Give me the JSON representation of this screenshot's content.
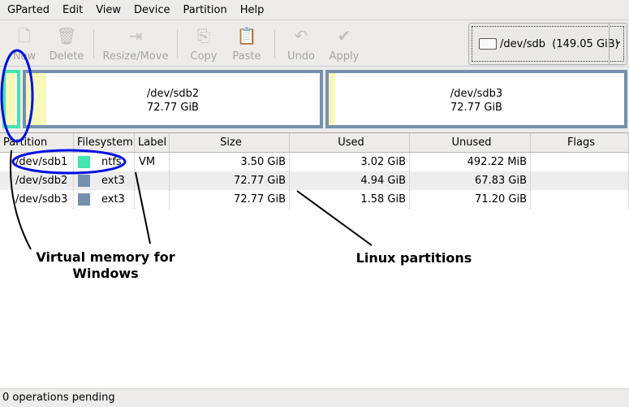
{
  "menu": [
    "GParted",
    "Edit",
    "View",
    "Device",
    "Partition",
    "Help"
  ],
  "toolbar": {
    "new": "New",
    "delete": "Delete",
    "resize": "Resize/Move",
    "copy": "Copy",
    "paste": "Paste",
    "undo": "Undo",
    "apply": "Apply"
  },
  "device": {
    "name": "/dev/sdb",
    "size": "(149.05 GiB)"
  },
  "map": [
    {
      "name": "/dev/sdb1",
      "color": "#43e4ae",
      "used_fraction": 0.86
    },
    {
      "name": "/dev/sdb2",
      "size": "72.77 GiB",
      "color": "#7590ae",
      "used_fraction": 0.068
    },
    {
      "name": "/dev/sdb3",
      "size": "72.77 GiB",
      "color": "#7590ae",
      "used_fraction": 0.022
    }
  ],
  "columns": [
    "Partition",
    "Filesystem",
    "Label",
    "Size",
    "Used",
    "Unused",
    "Flags"
  ],
  "rows": [
    {
      "partition": "/dev/sdb1",
      "fs": "ntfs",
      "color": "#43e4ae",
      "label": "VM",
      "size": "3.50 GiB",
      "used": "3.02 GiB",
      "unused": "492.22 MiB",
      "flags": ""
    },
    {
      "partition": "/dev/sdb2",
      "fs": "ext3",
      "color": "#7590ae",
      "label": "",
      "size": "72.77 GiB",
      "used": "4.94 GiB",
      "unused": "67.83 GiB",
      "flags": ""
    },
    {
      "partition": "/dev/sdb3",
      "fs": "ext3",
      "color": "#7590ae",
      "label": "",
      "size": "72.77 GiB",
      "used": "1.58 GiB",
      "unused": "71.20 GiB",
      "flags": ""
    }
  ],
  "annotations": {
    "vm": "Virtual memory for Windows",
    "linux": "Linux partitions"
  },
  "status": "0 operations pending"
}
